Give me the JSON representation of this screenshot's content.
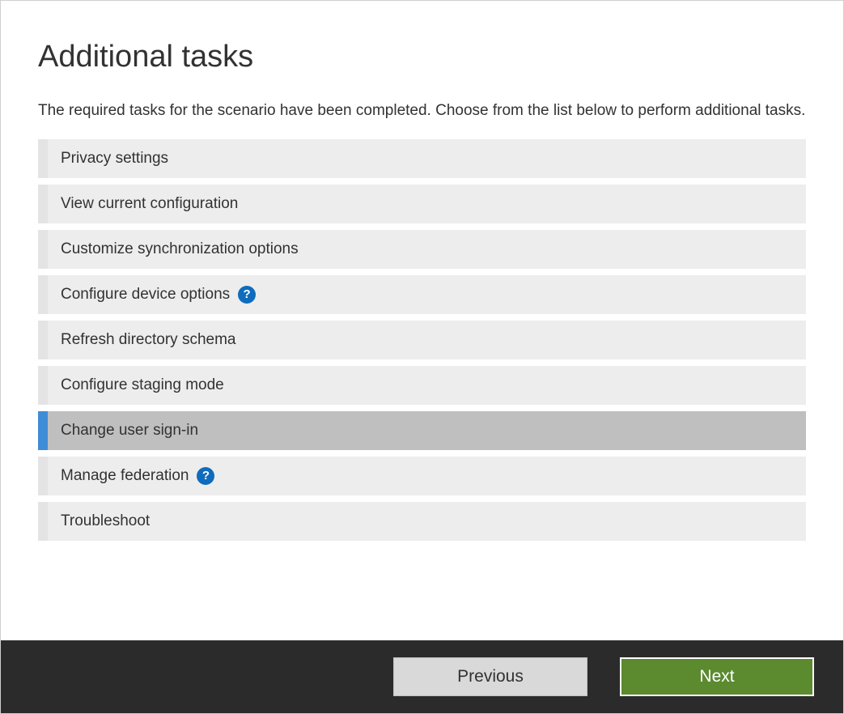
{
  "page": {
    "title": "Additional tasks",
    "description": "The required tasks for the scenario have been completed. Choose from the list below to perform additional tasks."
  },
  "tasks": [
    {
      "label": "Privacy settings",
      "help": false,
      "selected": false
    },
    {
      "label": "View current configuration",
      "help": false,
      "selected": false
    },
    {
      "label": "Customize synchronization options",
      "help": false,
      "selected": false
    },
    {
      "label": "Configure device options",
      "help": true,
      "selected": false
    },
    {
      "label": "Refresh directory schema",
      "help": false,
      "selected": false
    },
    {
      "label": "Configure staging mode",
      "help": false,
      "selected": false
    },
    {
      "label": "Change user sign-in",
      "help": false,
      "selected": true
    },
    {
      "label": "Manage federation",
      "help": true,
      "selected": false
    },
    {
      "label": "Troubleshoot",
      "help": false,
      "selected": false
    }
  ],
  "footer": {
    "previous_label": "Previous",
    "next_label": "Next"
  },
  "help_glyph": "?"
}
